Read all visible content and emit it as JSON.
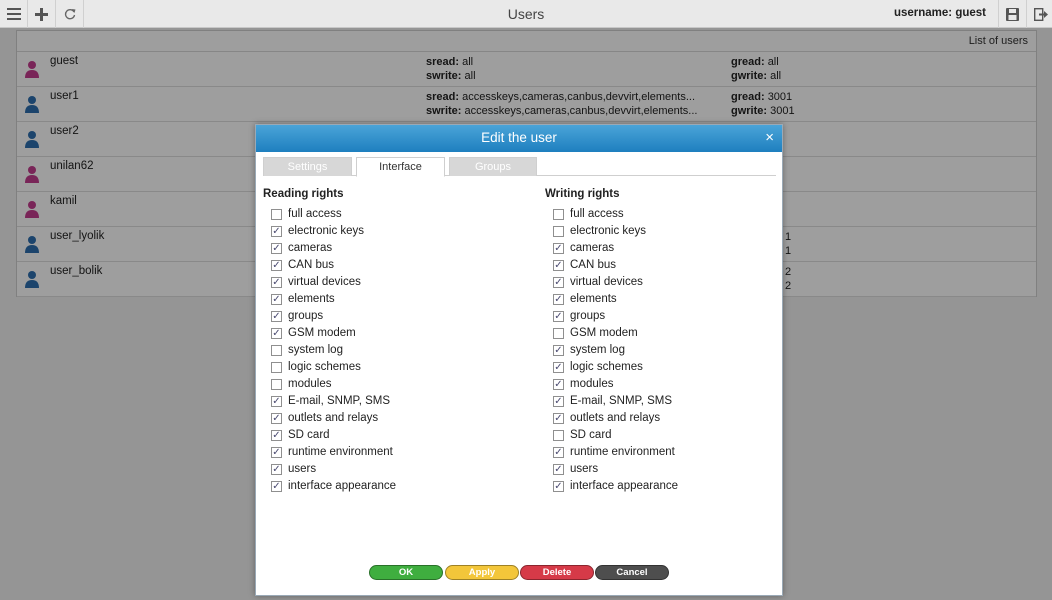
{
  "window": {
    "title": "Users",
    "user_label": "username: guest"
  },
  "toolbar": {
    "icons": [
      "menu-icon",
      "plus-icon",
      "refresh-icon",
      "save-icon",
      "logout-icon"
    ]
  },
  "list": {
    "header": "List of users",
    "users": [
      {
        "name": "guest",
        "gender": "female",
        "sread_key": "sread:",
        "sread": "all",
        "swrite_key": "swrite:",
        "swrite": "all",
        "gread_key": "gread:",
        "gread": "all",
        "gwrite_key": "gwrite:",
        "gwrite": "all"
      },
      {
        "name": "user1",
        "gender": "male",
        "sread_key": "sread:",
        "sread": "accesskeys,cameras,canbus,devvirt,elements...",
        "swrite_key": "swrite:",
        "swrite": "accesskeys,cameras,canbus,devvirt,elements...",
        "gread_key": "gread:",
        "gread": "3001",
        "gwrite_key": "gwrite:",
        "gwrite": "3001"
      },
      {
        "name": "user2",
        "gender": "male"
      },
      {
        "name": "unilan62",
        "gender": "female"
      },
      {
        "name": "kamil",
        "gender": "female"
      },
      {
        "name": "user_lyolik",
        "gender": "male",
        "gread_tail": "1",
        "gwrite_tail": "1"
      },
      {
        "name": "user_bolik",
        "gender": "male",
        "gread_tail": "2",
        "gwrite_tail": "2"
      }
    ]
  },
  "dialog": {
    "title": "Edit the user",
    "close": "×",
    "tabs": [
      {
        "label": "Settings",
        "active": false
      },
      {
        "label": "Interface",
        "active": true
      },
      {
        "label": "Groups",
        "active": false
      }
    ],
    "reading": {
      "title": "Reading rights",
      "items": [
        {
          "label": "full access",
          "checked": false
        },
        {
          "label": "electronic keys",
          "checked": true
        },
        {
          "label": "cameras",
          "checked": true
        },
        {
          "label": "CAN bus",
          "checked": true
        },
        {
          "label": "virtual devices",
          "checked": true
        },
        {
          "label": "elements",
          "checked": true
        },
        {
          "label": "groups",
          "checked": true
        },
        {
          "label": "GSM modem",
          "checked": true
        },
        {
          "label": "system log",
          "checked": false
        },
        {
          "label": "logic schemes",
          "checked": false
        },
        {
          "label": "modules",
          "checked": false
        },
        {
          "label": "E-mail, SNMP, SMS",
          "checked": true
        },
        {
          "label": "outlets and relays",
          "checked": true
        },
        {
          "label": "SD card",
          "checked": true
        },
        {
          "label": "runtime environment",
          "checked": true
        },
        {
          "label": "users",
          "checked": true
        },
        {
          "label": "interface appearance",
          "checked": true
        }
      ]
    },
    "writing": {
      "title": "Writing rights",
      "items": [
        {
          "label": "full access",
          "checked": false
        },
        {
          "label": "electronic keys",
          "checked": false
        },
        {
          "label": "cameras",
          "checked": true
        },
        {
          "label": "CAN bus",
          "checked": true
        },
        {
          "label": "virtual devices",
          "checked": true
        },
        {
          "label": "elements",
          "checked": true
        },
        {
          "label": "groups",
          "checked": true
        },
        {
          "label": "GSM modem",
          "checked": false
        },
        {
          "label": "system log",
          "checked": true
        },
        {
          "label": "logic schemes",
          "checked": true
        },
        {
          "label": "modules",
          "checked": true
        },
        {
          "label": "E-mail, SNMP, SMS",
          "checked": true
        },
        {
          "label": "outlets and relays",
          "checked": true
        },
        {
          "label": "SD card",
          "checked": false
        },
        {
          "label": "runtime environment",
          "checked": true
        },
        {
          "label": "users",
          "checked": true
        },
        {
          "label": "interface appearance",
          "checked": true
        }
      ]
    },
    "buttons": {
      "ok": "OK",
      "apply": "Apply",
      "delete": "Delete",
      "cancel": "Cancel"
    },
    "colors": {
      "ok": "#3fae3f",
      "apply": "#f3c63a",
      "delete": "#d63a48",
      "cancel": "#4e4e4e",
      "female": "#c43c8e",
      "male": "#2e6fae"
    }
  }
}
